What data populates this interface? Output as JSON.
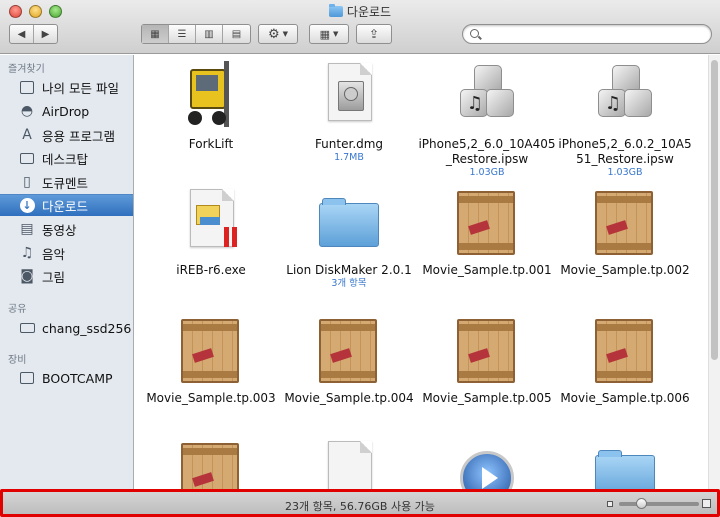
{
  "window": {
    "title": "다운로드"
  },
  "toolbar": {
    "back_icon": "chevron-left-icon",
    "forward_icon": "chevron-right-icon",
    "views": [
      "icon-view",
      "list-view",
      "column-view",
      "coverflow-view"
    ],
    "selected_view": "icon-view"
  },
  "sidebar": {
    "favorites_label": "즐겨찾기",
    "favorites": [
      {
        "label": "나의 모든 파일",
        "icon": "all-files-icon"
      },
      {
        "label": "AirDrop",
        "icon": "airdrop-icon"
      },
      {
        "label": "응용 프로그램",
        "icon": "applications-icon"
      },
      {
        "label": "데스크탑",
        "icon": "desktop-icon"
      },
      {
        "label": "도큐멘트",
        "icon": "documents-icon"
      },
      {
        "label": "다운로드",
        "icon": "downloads-icon",
        "selected": true
      },
      {
        "label": "동영상",
        "icon": "movies-icon"
      },
      {
        "label": "음악",
        "icon": "music-icon"
      },
      {
        "label": "그림",
        "icon": "pictures-icon"
      }
    ],
    "shared_label": "공유",
    "shared": [
      {
        "label": "chang_ssd256",
        "icon": "computer-icon"
      }
    ],
    "devices_label": "장비",
    "devices": [
      {
        "label": "BOOTCAMP",
        "icon": "disk-icon"
      }
    ]
  },
  "files": [
    {
      "name": "ForkLift",
      "info": "",
      "kind": "app-forklift"
    },
    {
      "name": "Funter.dmg",
      "info": "1.7MB",
      "kind": "dmg"
    },
    {
      "name": "iPhone5,2_6.0_10A405_Restore.ipsw",
      "info": "1.03GB",
      "kind": "ipsw"
    },
    {
      "name": "iPhone5,2_6.0.2_10A551_Restore.ipsw",
      "info": "1.03GB",
      "kind": "ipsw"
    },
    {
      "name": "iREB-r6.exe",
      "info": "",
      "kind": "exe"
    },
    {
      "name": "Lion DiskMaker 2.0.1",
      "info": "3개 항목",
      "kind": "folder"
    },
    {
      "name": "Movie_Sample.tp.001",
      "info": "",
      "kind": "crate"
    },
    {
      "name": "Movie_Sample.tp.002",
      "info": "",
      "kind": "crate"
    },
    {
      "name": "Movie_Sample.tp.003",
      "info": "",
      "kind": "crate"
    },
    {
      "name": "Movie_Sample.tp.004",
      "info": "",
      "kind": "crate"
    },
    {
      "name": "Movie_Sample.tp.005",
      "info": "",
      "kind": "crate"
    },
    {
      "name": "Movie_Sample.tp.006",
      "info": "",
      "kind": "crate"
    },
    {
      "name": "",
      "info": "",
      "kind": "crate"
    },
    {
      "name": "",
      "info": "",
      "kind": "doc"
    },
    {
      "name": "",
      "info": "",
      "kind": "quicktime"
    },
    {
      "name": "",
      "info": "",
      "kind": "folder"
    }
  ],
  "status": {
    "text": "23개 항목, 56.76GB 사용 가능",
    "icon_size_level": 0.25
  }
}
